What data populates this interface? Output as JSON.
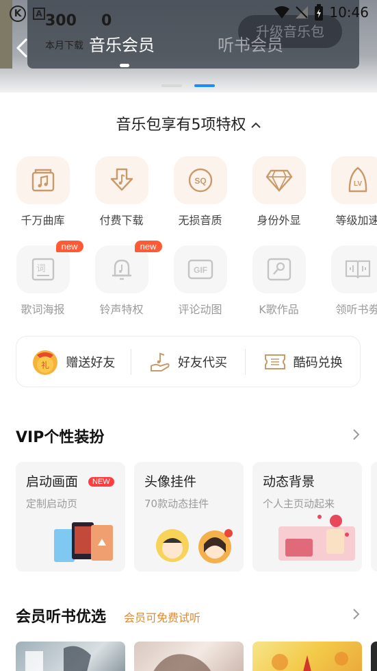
{
  "status_bar": {
    "time": "10:46",
    "left_icons": [
      "k-icon",
      "a-icon"
    ]
  },
  "header": {
    "stat_1": "300",
    "stat_2": "0",
    "stat_label": "本月下载",
    "upgrade_button": "升级音乐包",
    "tabs": [
      {
        "label": "音乐会员",
        "active": true
      },
      {
        "label": "听书会员",
        "active": false
      }
    ]
  },
  "privileges": {
    "title": "音乐包享有5项特权",
    "row1": [
      {
        "label": "千万曲库",
        "icon": "music-library-icon"
      },
      {
        "label": "付费下载",
        "icon": "download-icon"
      },
      {
        "label": "无损音质",
        "icon": "sq-quality-icon",
        "icon_text": "SQ"
      },
      {
        "label": "身份外显",
        "icon": "diamond-icon"
      },
      {
        "label": "等级加速",
        "icon": "level-rocket-icon",
        "icon_text": "LV"
      }
    ],
    "row2": [
      {
        "label": "歌词海报",
        "icon": "lyrics-poster-icon",
        "icon_text": "词",
        "badge": "new"
      },
      {
        "label": "铃声特权",
        "icon": "ringtone-bell-icon",
        "badge": "new"
      },
      {
        "label": "评论动图",
        "icon": "gif-icon",
        "icon_text": "GIF"
      },
      {
        "label": "K歌作品",
        "icon": "karaoke-icon"
      },
      {
        "label": "领听书劵",
        "icon": "audiobook-icon"
      }
    ]
  },
  "actions": [
    {
      "label": "赠送好友",
      "icon": "gift-bag-icon",
      "icon_text": "礼"
    },
    {
      "label": "好友代买",
      "icon": "hand-music-icon"
    },
    {
      "label": "酷码兑换",
      "icon": "ticket-icon"
    }
  ],
  "vip_section": {
    "title": "VIP个性装扮",
    "cards": [
      {
        "title": "启动画面",
        "subtitle": "定制启动页",
        "badge": "NEW"
      },
      {
        "title": "头像挂件",
        "subtitle": "70款动态挂件"
      },
      {
        "title": "动态背景",
        "subtitle": "个人主页动起来"
      }
    ]
  },
  "books_section": {
    "title": "会员听书优选",
    "subtitle": "会员可免费试听"
  },
  "colors": {
    "accent_blue": "#1b8cff",
    "badge_red": "#ff5a36",
    "icon_gold": "#c89a6a",
    "sub_orange": "#e08a2c"
  }
}
